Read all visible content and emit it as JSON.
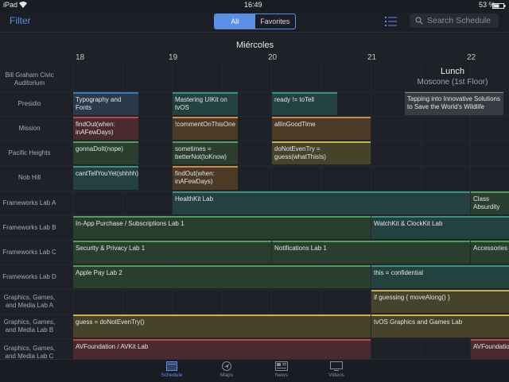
{
  "status": {
    "device": "iPad",
    "time": "16:49",
    "battery": "53 %"
  },
  "nav": {
    "filter": "Filter",
    "segments": [
      "All",
      "Favorites"
    ],
    "search_placeholder": "Search Schedule"
  },
  "day": "Miércoles",
  "hours": [
    "18",
    "19",
    "20",
    "21",
    "22"
  ],
  "rooms": [
    "Bill Graham Civic Auditorium",
    "Presidio",
    "Mission",
    "Pacific Heights",
    "Nob Hill",
    "Frameworks Lab A",
    "Frameworks Lab B",
    "Frameworks Lab C",
    "Frameworks Lab D",
    "Graphics, Games, and Media Lab A",
    "Graphics, Games, and Media Lab B",
    "Graphics, Games, and Media Lab C"
  ],
  "lunch": {
    "title": "Lunch",
    "location": "Moscone (1st Floor)"
  },
  "sessions": [
    "Typography and Fonts",
    "Mastering UIKit on tvOS",
    "ready != toTell",
    "Tapping into Innovative Solutions to Save the World's Wildlife",
    "findOut(when: inAFewDays)",
    "!commentOnThisOne",
    "allInGoodTime",
    "gonnaDoIt(nope)",
    "sometimes = betterNot(toKnow)",
    "doNotEvenTry = guess(whatThisIs)",
    "cantTellYouYet(shhhh)",
    "findOut(when: inAFewDays)",
    "HealthKit Lab",
    "Class Absurdity",
    "In-App Purchase / Subscriptions Lab 1",
    "WatchKit & ClockKit Lab",
    "Security & Privacy Lab 1",
    "Notifications Lab 1",
    "Accessories",
    "Apple Pay Lab 2",
    "this = confidential",
    "if guessing { moveAlong() }",
    "guess = doNotEvenTry()",
    "tvOS Graphics and Games Lab",
    "AVFoundation / AVKit Lab",
    "AVFoundation"
  ],
  "tabs": [
    "Schedule",
    "Maps",
    "News",
    "Videos"
  ],
  "colors": {
    "accent": "#5b8fe6",
    "background": "#1f2129"
  }
}
